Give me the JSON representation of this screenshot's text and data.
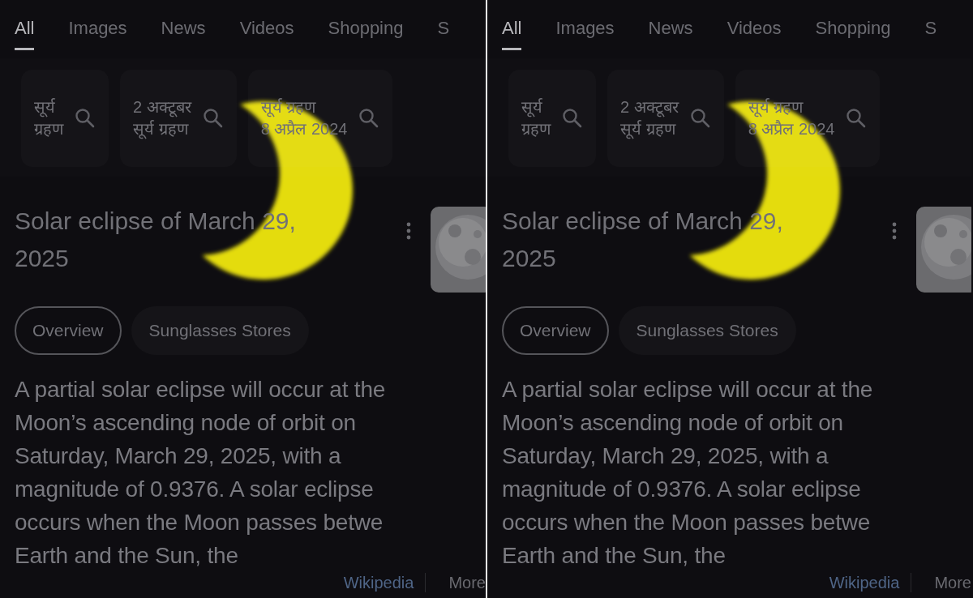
{
  "panels": [
    {
      "tabs": [
        {
          "label": "All",
          "selected": true
        },
        {
          "label": "Images",
          "selected": false
        },
        {
          "label": "News",
          "selected": false
        },
        {
          "label": "Videos",
          "selected": false
        },
        {
          "label": "Shopping",
          "selected": false
        },
        {
          "label": "S",
          "selected": false
        }
      ],
      "suggestions": [
        {
          "lines": [
            "सूर्य",
            "ग्रहण"
          ]
        },
        {
          "lines": [
            "2 अक्टूबर",
            "सूर्य ग्रहण"
          ]
        },
        {
          "lines": [
            "सूर्य ग्रहण",
            "8 अप्रैल 2024"
          ]
        }
      ],
      "result": {
        "title_lines": [
          "Solar eclipse of March 29,",
          "2025"
        ],
        "thumbnail": {
          "kind": "picture"
        },
        "chips": [
          {
            "label": "Overview",
            "selected": true
          },
          {
            "label": "Sunglasses Stores",
            "selected": false
          }
        ],
        "text_lines": [
          "A partial solar eclipse will occur at the",
          "Moon’s ascending node of orbit on",
          "Saturday, March 29, 2025, with a",
          "magnitude of 0.9376. A solar eclipse",
          "occurs when the Moon passes betwe",
          "Earth and the Sun, the"
        ],
        "source": "Wikipedia",
        "more": "More"
      }
    },
    {
      "tabs": [
        {
          "label": "All",
          "selected": true
        },
        {
          "label": "Images",
          "selected": false
        },
        {
          "label": "News",
          "selected": false
        },
        {
          "label": "Videos",
          "selected": false
        },
        {
          "label": "Shopping",
          "selected": false
        },
        {
          "label": "S",
          "selected": false
        }
      ],
      "suggestions": [
        {
          "lines": [
            "सूर्य",
            "ग्रहण"
          ]
        },
        {
          "lines": [
            "2 अक्टूबर",
            "सूर्य ग्रहण"
          ]
        },
        {
          "lines": [
            "सूर्य ग्रहण",
            "8 अप्रैल 2024"
          ]
        }
      ],
      "result": {
        "title_lines": [
          "Solar eclipse of March 29,",
          "2025"
        ],
        "thumbnail": {
          "kind": "picture"
        },
        "chips": [
          {
            "label": "Overview",
            "selected": true
          },
          {
            "label": "Sunglasses Stores",
            "selected": false
          }
        ],
        "text_lines": [
          "A partial solar eclipse will occur at the",
          "Moon’s ascending node of orbit on",
          "Saturday, March 29, 2025, with a",
          "magnitude of 0.9376. A solar eclipse",
          "occurs when the Moon passes betwe",
          "Earth and the Sun, the"
        ],
        "source": "Wikipedia",
        "more": "More"
      }
    }
  ]
}
